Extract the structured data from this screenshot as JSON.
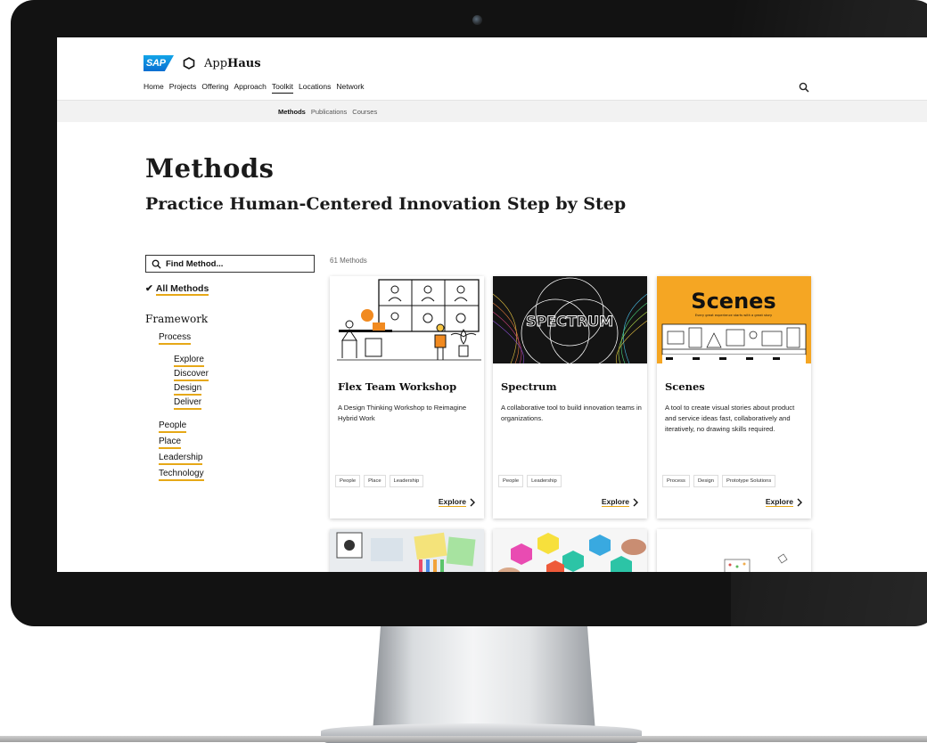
{
  "header": {
    "sap_logo_text": "SAP",
    "brand_prefix": "App",
    "brand_bold": "Haus",
    "nav": [
      "Home",
      "Projects",
      "Offering",
      "Approach",
      "Toolkit",
      "Locations",
      "Network"
    ],
    "active_nav": "Toolkit",
    "subnav": [
      "Methods",
      "Publications",
      "Courses"
    ],
    "active_subnav": "Methods"
  },
  "page": {
    "title": "Methods",
    "subtitle": "Practice Human-Centered Innovation Step by Step"
  },
  "sidebar": {
    "search_placeholder": "Find Method...",
    "all_methods": "All Methods",
    "framework_heading": "Framework",
    "process": "Process",
    "process_items": [
      "Explore",
      "Discover",
      "Design",
      "Deliver"
    ],
    "other_items": [
      "People",
      "Place",
      "Leadership",
      "Technology"
    ]
  },
  "results": {
    "count_label": "61 Methods",
    "cards": [
      {
        "title": "Flex Team Workshop",
        "description": "A Design Thinking Workshop to Reimagine Hybrid Work",
        "tags": [
          "People",
          "Place",
          "Leadership"
        ],
        "cta": "Explore"
      },
      {
        "title": "Spectrum",
        "thumb_text": "SPECTRUM",
        "description": "A collaborative tool to build innovation teams in organizations.",
        "tags": [
          "People",
          "Leadership"
        ],
        "cta": "Explore"
      },
      {
        "title": "Scenes",
        "thumb_text": "Scenes",
        "thumb_subtext": "Every great experience starts with a great story",
        "description": "A tool to create visual stories about product and service ideas fast, collaboratively and iteratively, no drawing skills required.",
        "tags": [
          "Process",
          "Design",
          "Prototype Solutions"
        ],
        "cta": "Explore"
      }
    ]
  },
  "colors": {
    "accent_underline": "#e6a817",
    "scenes_bg": "#f5a623",
    "spectrum_bg": "#141414",
    "sap_blue": "#0a6ed1"
  },
  "icons": [
    "search-icon",
    "apphaus-logo-icon",
    "checkmark-icon",
    "chevron-right-icon"
  ]
}
